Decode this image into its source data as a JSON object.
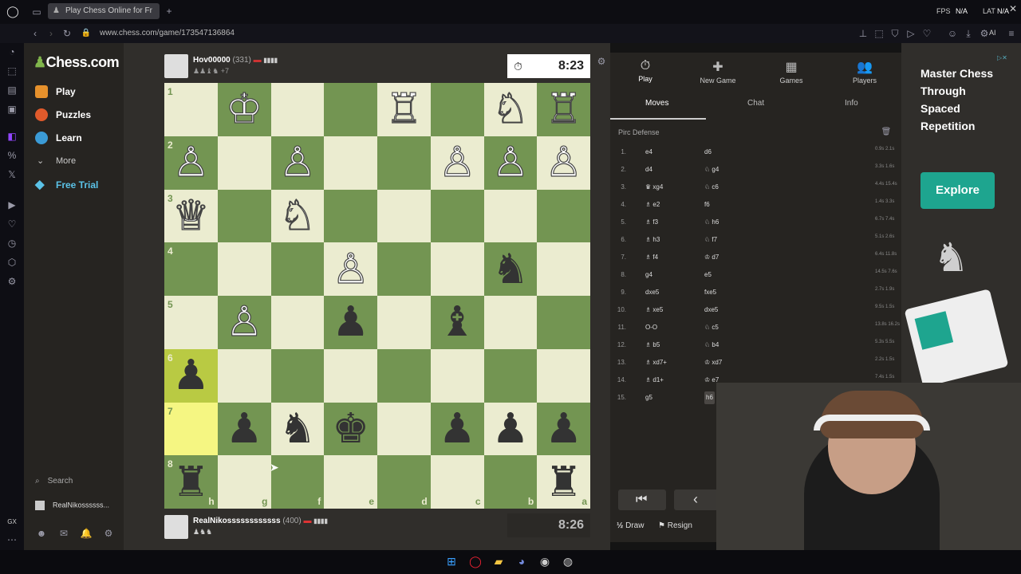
{
  "browser": {
    "tab_title": "Play Chess Online for Fr",
    "url": "www.chess.com/game/173547136864",
    "fps_label": "FPS",
    "fps_value": "N/A",
    "lat_label": "LAT",
    "lat_value": "N/A",
    "ai_label": "AI"
  },
  "sidebar": {
    "logo": "Chess.com",
    "items": [
      {
        "label": "Play",
        "color": "#e6912c"
      },
      {
        "label": "Puzzles",
        "color": "#e05a2b"
      },
      {
        "label": "Learn",
        "color": "#3b9bd6"
      },
      {
        "label": "More"
      },
      {
        "label": "Free Trial",
        "color": "#5bc2e7"
      }
    ],
    "search_label": "Search",
    "username": "RealNikossssss..."
  },
  "top_player": {
    "name": "Hov00000",
    "rating": "(331)",
    "extra": "+7",
    "clock": "8:23"
  },
  "bottom_player": {
    "name": "RealNikossssssssssss",
    "rating": "(400)",
    "clock": "8:26"
  },
  "board": {
    "ranks": [
      "1",
      "2",
      "3",
      "4",
      "5",
      "6",
      "7",
      "8"
    ],
    "files": [
      "h",
      "g",
      "f",
      "e",
      "d",
      "c",
      "b",
      "a"
    ],
    "rows": [
      [
        "",
        "wK",
        "",
        "",
        "wR",
        "",
        "wN",
        "wR"
      ],
      [
        "wP",
        "",
        "wP",
        "",
        "",
        "wP",
        "wP",
        "wP"
      ],
      [
        "wQ",
        "",
        "wN",
        "",
        "",
        "",
        "",
        ""
      ],
      [
        "",
        "",
        "",
        "wP",
        "",
        "",
        "bN",
        ""
      ],
      [
        "",
        "wP",
        "",
        "bP",
        "",
        "bB",
        "",
        ""
      ],
      [
        "bP",
        "",
        "",
        "",
        "",
        "",
        "",
        ""
      ],
      [
        "",
        "bP",
        "bN",
        "bK",
        "",
        "bP",
        "bP",
        "bP"
      ],
      [
        "bR",
        "",
        "",
        "",
        "",
        "",
        "",
        "bR"
      ]
    ],
    "highlights": [
      "5-0",
      "6-0"
    ]
  },
  "panel": {
    "tabs": [
      {
        "label": "Play",
        "icon": "⏱"
      },
      {
        "label": "New Game",
        "icon": "✚"
      },
      {
        "label": "Games",
        "icon": "▦"
      },
      {
        "label": "Players",
        "icon": "👥"
      }
    ],
    "subtabs": [
      "Moves",
      "Chat",
      "Info"
    ],
    "opening": "Pirc Defense",
    "draw_label": "Draw",
    "draw_prefix": "½",
    "resign_label": "Resign"
  },
  "moves": [
    {
      "n": "1.",
      "w": "e4",
      "b": "d6",
      "t": "0.9s 2.1s"
    },
    {
      "n": "2.",
      "w": "d4",
      "b": "♘ g4",
      "t": "3.3s 1.6s"
    },
    {
      "n": "3.",
      "w": "♛ xg4",
      "b": "♘ c6",
      "t": "4.4s 15.4s"
    },
    {
      "n": "4.",
      "w": "♗ e2",
      "b": "f6",
      "t": "1.4s 3.3s"
    },
    {
      "n": "5.",
      "w": "♗ f3",
      "b": "♘ h6",
      "t": "6.7s 7.4s"
    },
    {
      "n": "6.",
      "w": "♗ h3",
      "b": "♘ f7",
      "t": "5.1s 2.6s"
    },
    {
      "n": "7.",
      "w": "♗ f4",
      "b": "♔ d7",
      "t": "6.4s 11.8s"
    },
    {
      "n": "8.",
      "w": "g4",
      "b": "e5",
      "t": "14.5s 7.6s"
    },
    {
      "n": "9.",
      "w": "dxe5",
      "b": "fxe5",
      "t": "2.7s 1.9s"
    },
    {
      "n": "10.",
      "w": "♗ xe5",
      "b": "dxe5",
      "t": "9.5s 1.5s"
    },
    {
      "n": "11.",
      "w": "O-O",
      "b": "♘ c5",
      "t": "13.8s 16.2s"
    },
    {
      "n": "12.",
      "w": "♗ b5",
      "b": "♘ b4",
      "t": "5.3s 5.5s"
    },
    {
      "n": "13.",
      "w": "♗ xd7+",
      "b": "♔ xd7",
      "t": "2.2s 1.5s"
    },
    {
      "n": "14.",
      "w": "♗ d1+",
      "b": "♔ e7",
      "t": "7.4s 1.5s"
    },
    {
      "n": "15.",
      "w": "g5",
      "b": "h6",
      "t": ""
    }
  ],
  "ad": {
    "title": "Master Chess Through Spaced Repetition",
    "cta": "Explore"
  }
}
